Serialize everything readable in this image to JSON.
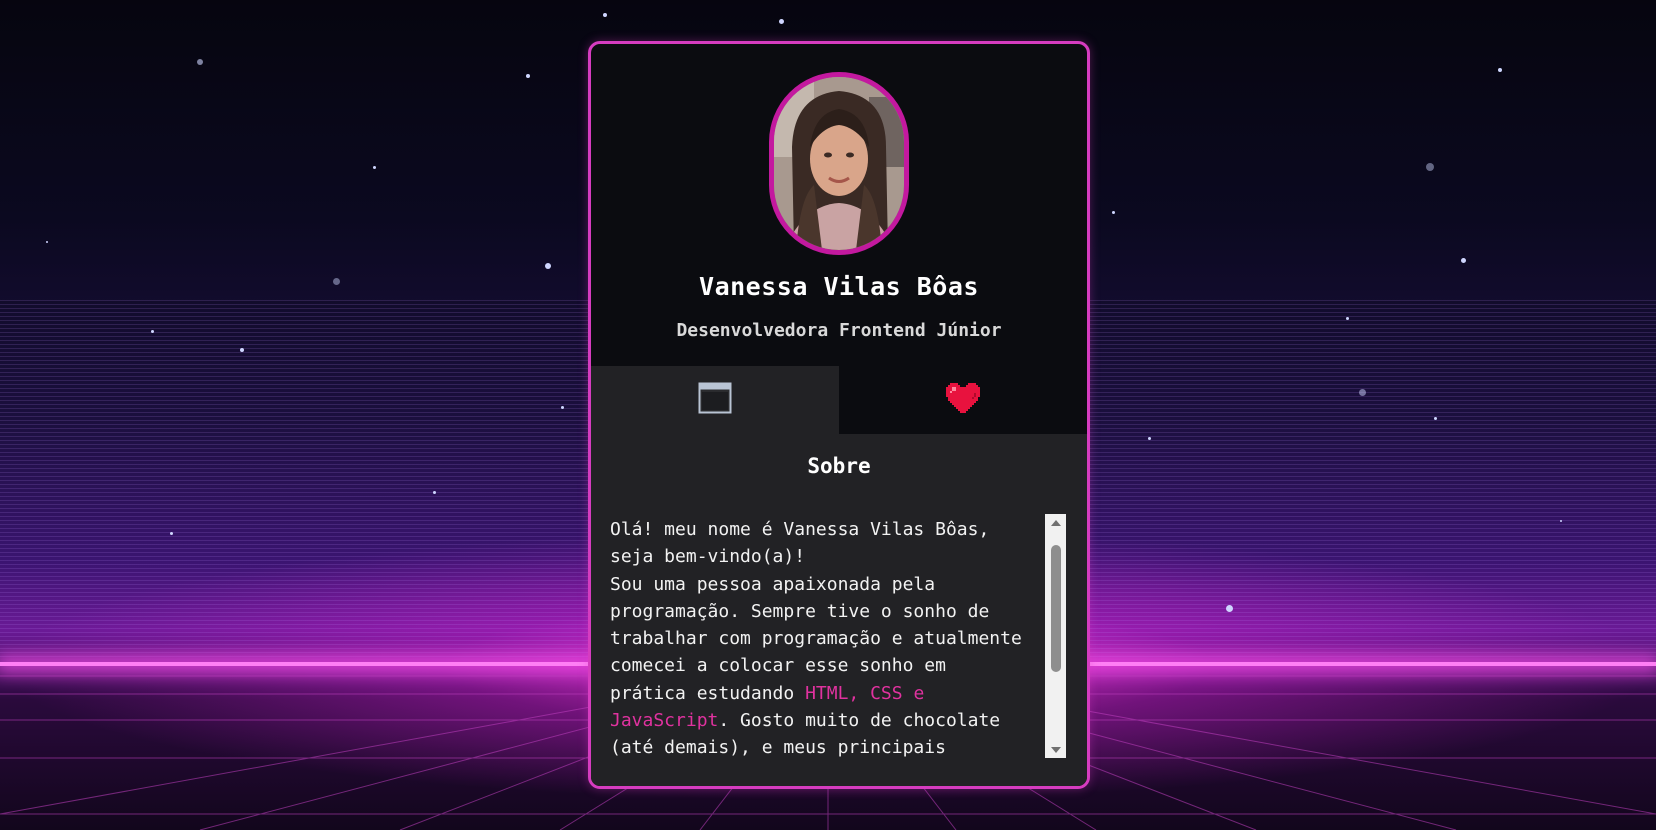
{
  "profile": {
    "name": "Vanessa Vilas Bôas",
    "role": "Desenvolvedora Frontend Júnior",
    "photo_alt": "Foto de Vanessa Vilas Bôas"
  },
  "tabs": [
    {
      "icon": "window-icon",
      "active": true
    },
    {
      "icon": "heart-icon",
      "active": false
    }
  ],
  "about": {
    "title": "Sobre",
    "intro": "Olá! meu nome é Vanessa Vilas Bôas,\nseja bem-vindo(a)!\nSou uma pessoa apaixonada pela\nprogramação. Sempre tive o sonho de\ntrabalhar com programação e atualmente\ncomecei a colocar esse sonho em\nprática estudando ",
    "highlight": "HTML, CSS e\nJavaScript",
    "outro": ". Gosto muito de chocolate\n(até demais), e meus principais"
  },
  "colors": {
    "accent": "#d63cc0",
    "avatar_border": "#c3199f",
    "highlight": "#e0329f",
    "card_bg": "#0b0c10",
    "panel_bg": "#222225"
  }
}
